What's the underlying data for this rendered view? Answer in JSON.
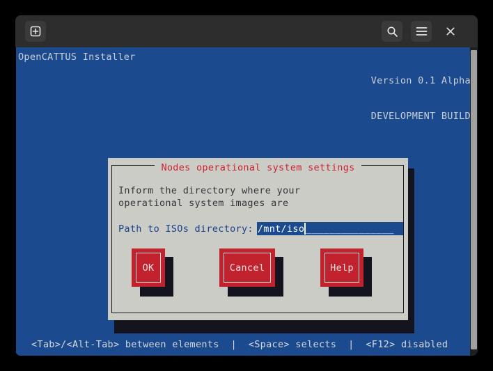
{
  "window": {
    "titlebar": {
      "new_tab_icon": "plus-in-square-icon",
      "search_icon": "search-icon",
      "menu_icon": "hamburger-menu-icon",
      "close_icon": "close-icon",
      "close_label": "×"
    }
  },
  "tui": {
    "app_title": "OpenCATTUS Installer",
    "version_line1": "Version 0.1 Alpha",
    "version_line2": "DEVELOPMENT BUILD",
    "statusbar": "<Tab>/<Alt-Tab> between elements  |  <Space> selects  |  <F12> disabled",
    "scrollbar_name": "vertical-scrollbar"
  },
  "dialog": {
    "title": "Nodes operational system settings",
    "body": "Inform the directory where your\noperational system images are",
    "field": {
      "label": "Path to ISOs directory:",
      "value": "/mnt/iso",
      "placeholder": "",
      "fill": "_______________"
    },
    "buttons": [
      {
        "name": "ok-button",
        "label": "OK"
      },
      {
        "name": "cancel-button",
        "label": "Cancel"
      },
      {
        "name": "help-button",
        "label": "Help"
      }
    ]
  },
  "colors": {
    "tui_background": "#1b4a8f",
    "dialog_background": "#ccccc7",
    "accent_red": "#c2222e",
    "title_red": "#cc2233",
    "label_blue": "#17418c",
    "shadow": "#14141f",
    "titlebar": "#2d2d2d"
  }
}
